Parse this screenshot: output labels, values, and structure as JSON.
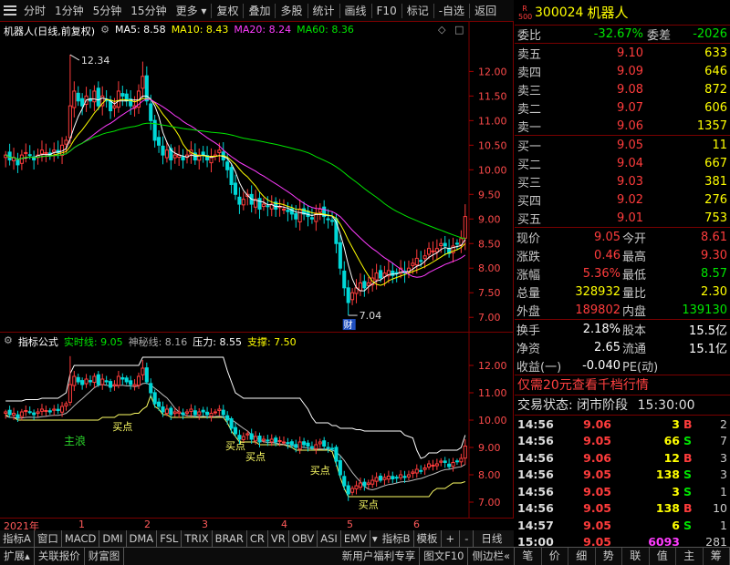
{
  "toolbar": {
    "left": [
      "分时",
      "1分钟",
      "5分钟",
      "15分钟",
      "更多"
    ],
    "right": [
      "复权",
      "叠加",
      "多股",
      "统计",
      "画线",
      "F10",
      "标记",
      "-自选",
      "返回"
    ]
  },
  "main_legend": {
    "title": "机器人(日线,前复权)",
    "ma5": "MA5: 8.58",
    "ma10": "MA10: 8.43",
    "ma20": "MA20: 8.24",
    "ma60": "MA60: 8.36",
    "high_label": "12.34",
    "low_label": "7.04",
    "cai": "财"
  },
  "ind_legend": {
    "title": "指标公式",
    "a": "实时线: 9.05",
    "b": "神秘线: 8.16",
    "c": "压力: 8.55",
    "d": "支撑: 7.50",
    "watermark": "主浪",
    "buy": "买点"
  },
  "chart_data": {
    "type": "candlestick",
    "ylim": [
      6.8,
      12.6
    ],
    "y_ticks": [
      "12.00",
      "11.50",
      "11.00",
      "10.50",
      "10.00",
      "9.50",
      "9.00",
      "8.50",
      "8.00",
      "7.50",
      "7.00"
    ],
    "ind_ticks": [
      "12.00",
      "11.00",
      "10.00",
      "9.00",
      "8.00",
      "7.00"
    ],
    "x_ticks": [
      "2021年",
      "1",
      "2",
      "3",
      "4",
      "5",
      "6"
    ],
    "close": [
      10.3,
      10.2,
      10.25,
      10.1,
      10.3,
      10.35,
      10.3,
      10.2,
      10.3,
      10.4,
      10.35,
      10.3,
      10.4,
      10.35,
      10.5,
      10.6,
      11.3,
      11.6,
      11.4,
      11.3,
      11.5,
      11.4,
      11.6,
      11.3,
      11.5,
      11.4,
      11.2,
      11.3,
      11.6,
      11.5,
      11.4,
      11.3,
      11.3,
      11.6,
      11.9,
      11.4,
      11.0,
      10.6,
      10.5,
      10.3,
      10.4,
      10.2,
      10.3,
      10.3,
      10.2,
      10.3,
      10.4,
      10.2,
      10.3,
      10.3,
      10.2,
      10.25,
      10.3,
      10.4,
      10.2,
      10.0,
      9.7,
      9.5,
      9.3,
      9.4,
      9.5,
      9.3,
      9.4,
      9.2,
      9.3,
      9.25,
      9.3,
      9.2,
      9.25,
      9.2,
      9.15,
      9.1,
      9.0,
      9.2,
      9.1,
      9.05,
      9.0,
      9.1,
      9.2,
      9.05,
      9.0,
      8.95,
      8.5,
      8.0,
      7.6,
      7.3,
      7.5,
      7.6,
      7.7,
      7.6,
      7.7,
      7.8,
      7.9,
      7.8,
      7.9,
      7.95,
      7.85,
      7.9,
      8.0,
      7.9,
      8.0,
      8.1,
      8.2,
      8.15,
      8.25,
      8.4,
      8.35,
      8.4,
      8.5,
      8.45,
      8.3,
      8.45,
      8.5,
      8.6,
      9.05
    ]
  },
  "right": {
    "r_label": "R",
    "r_sub": "500",
    "code": "300024",
    "name": "机器人",
    "webi": {
      "l1": "委比",
      "v1": "-32.67%",
      "l2": "委差",
      "v2": "-2026"
    },
    "asks": [
      {
        "l": "卖五",
        "p": "9.10",
        "v": "633"
      },
      {
        "l": "卖四",
        "p": "9.09",
        "v": "646"
      },
      {
        "l": "卖三",
        "p": "9.08",
        "v": "872"
      },
      {
        "l": "卖二",
        "p": "9.07",
        "v": "606"
      },
      {
        "l": "卖一",
        "p": "9.06",
        "v": "1357"
      }
    ],
    "bids": [
      {
        "l": "买一",
        "p": "9.05",
        "v": "11"
      },
      {
        "l": "买二",
        "p": "9.04",
        "v": "667"
      },
      {
        "l": "买三",
        "p": "9.03",
        "v": "381"
      },
      {
        "l": "买四",
        "p": "9.02",
        "v": "276"
      },
      {
        "l": "买五",
        "p": "9.01",
        "v": "753"
      }
    ],
    "quote": [
      {
        "l1": "现价",
        "v1": "9.05",
        "l2": "今开",
        "v2": "8.61"
      },
      {
        "l1": "涨跌",
        "v1": "0.46",
        "l2": "最高",
        "v2": "9.30"
      },
      {
        "l1": "涨幅",
        "v1": "5.36%",
        "l2": "最低",
        "v2": "8.57"
      },
      {
        "l1": "总量",
        "v1": "328932",
        "l2": "量比",
        "v2": "2.30"
      },
      {
        "l1": "外盘",
        "v1": "189802",
        "l2": "内盘",
        "v2": "139130"
      }
    ],
    "stats": [
      {
        "l1": "换手",
        "v1": "2.18%",
        "l2": "股本",
        "v2": "15.5亿"
      },
      {
        "l1": "净资",
        "v1": "2.65",
        "l2": "流通",
        "v2": "15.1亿"
      },
      {
        "l1": "收益(一)",
        "v1": "-0.040",
        "l2": "PE(动)",
        "v2": ""
      }
    ],
    "promo": "仅需20元查看千档行情",
    "status_label": "交易状态: 闭市阶段",
    "status_time": "15:30:00",
    "ticks": [
      {
        "t": "14:56",
        "p": "9.06",
        "v": "3",
        "s": "B",
        "n": "2"
      },
      {
        "t": "14:56",
        "p": "9.05",
        "v": "66",
        "s": "S",
        "n": "7"
      },
      {
        "t": "14:56",
        "p": "9.06",
        "v": "12",
        "s": "B",
        "n": "3"
      },
      {
        "t": "14:56",
        "p": "9.05",
        "v": "138",
        "s": "S",
        "n": "3"
      },
      {
        "t": "14:56",
        "p": "9.05",
        "v": "3",
        "s": "S",
        "n": "1"
      },
      {
        "t": "14:56",
        "p": "9.05",
        "v": "138",
        "s": "B",
        "n": "10"
      },
      {
        "t": "14:57",
        "p": "9.05",
        "v": "6",
        "s": "S",
        "n": "1"
      },
      {
        "t": "15:00",
        "p": "9.05",
        "v": "6093",
        "s": "",
        "n": "281"
      }
    ],
    "bottom_tabs": [
      "笔",
      "价",
      "细",
      "势",
      "联",
      "值",
      "主",
      "筹"
    ]
  },
  "tabs_row": [
    "指标A",
    "窗口",
    "MACD",
    "DMI",
    "DMA",
    "FSL",
    "TRIX",
    "BRAR",
    "CR",
    "VR",
    "OBV",
    "ASI",
    "EMV",
    "指标B",
    "模板",
    "+",
    "-",
    "日线"
  ],
  "bottom_row": {
    "left": [
      "扩展",
      "关联报价",
      "财富图"
    ],
    "right": [
      "新用户福利专享",
      "图文F10",
      "侧边栏"
    ]
  }
}
